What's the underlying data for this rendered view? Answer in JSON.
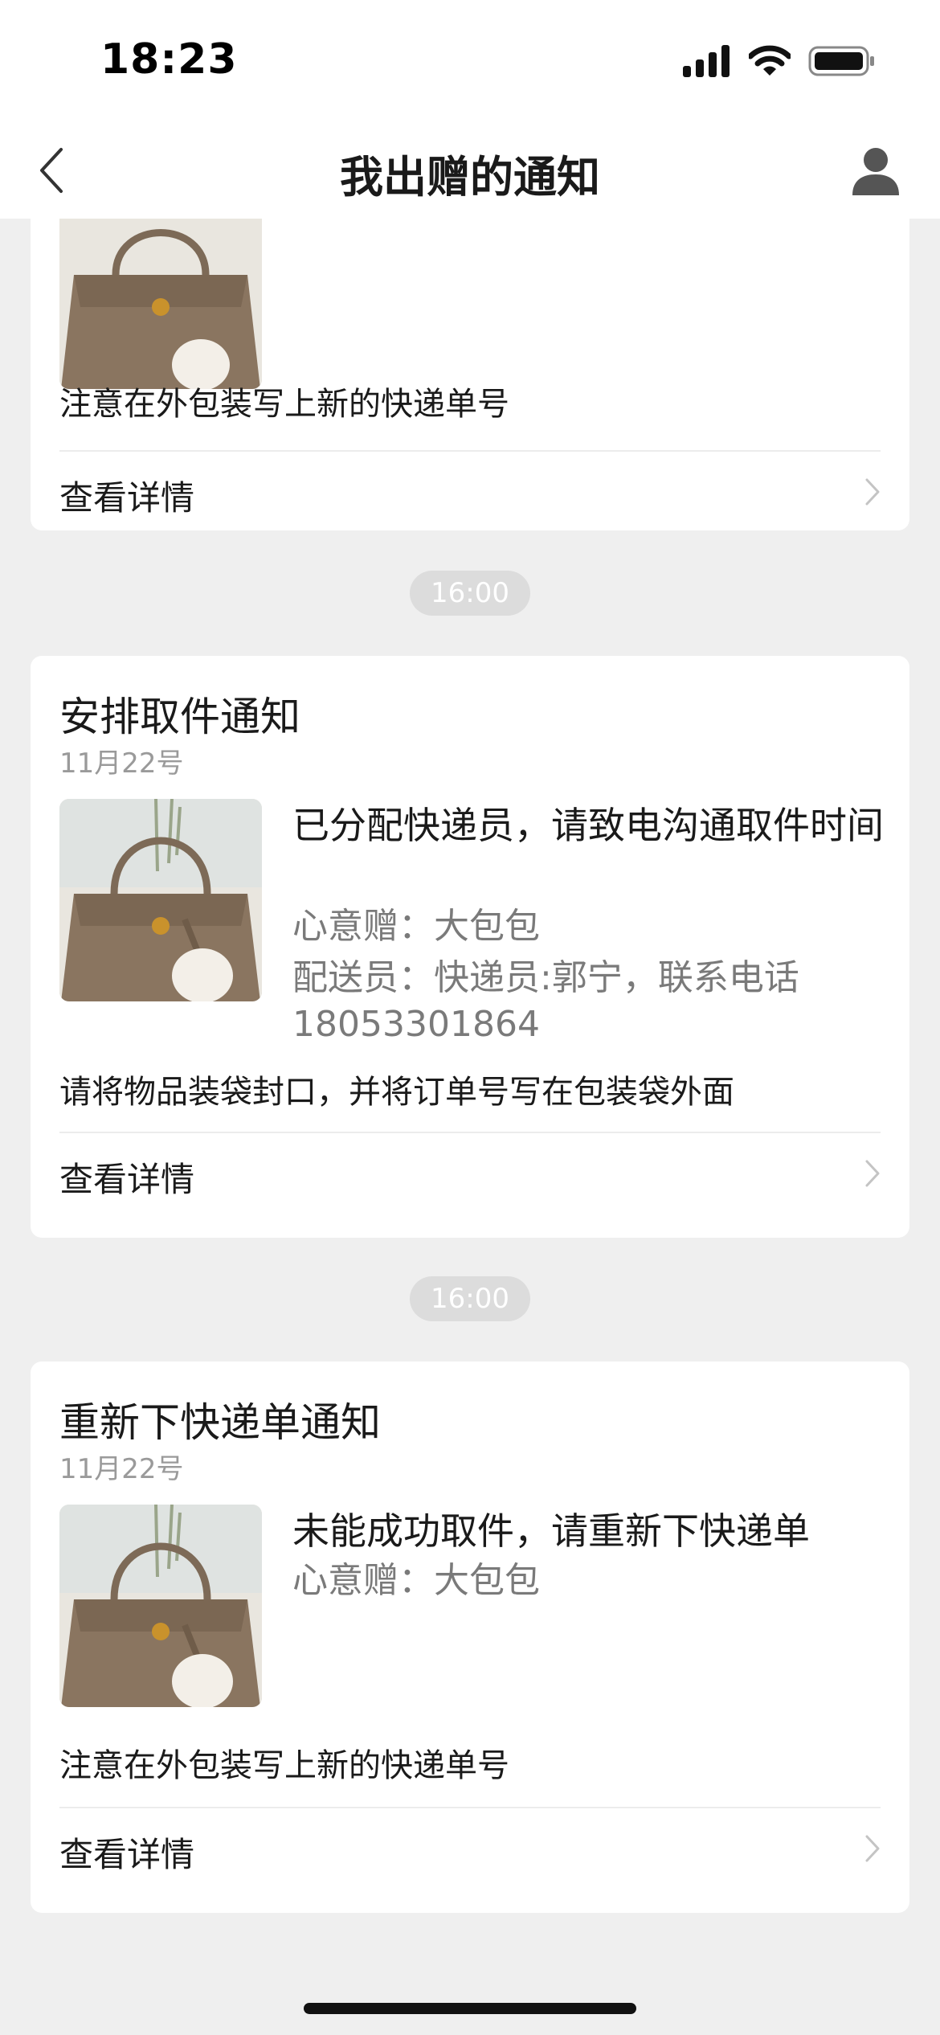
{
  "status_bar": {
    "time": "18:23"
  },
  "nav": {
    "title": "我出赠的通知"
  },
  "cards": [
    {
      "note": "注意在外包装写上新的快递单号",
      "view_detail": "查看详情"
    },
    {
      "time_label": "16:00",
      "title": "安排取件通知",
      "date": "11月22号",
      "main": "已分配快递员，请致电沟通取件时间",
      "gift": "心意赠：大包包",
      "courier": "配送员：快递员:郭宁，联系电话18053301864",
      "note": "请将物品装袋封口，并将订单号写在包装袋外面",
      "view_detail": "查看详情"
    },
    {
      "time_label": "16:00",
      "title": "重新下快递单通知",
      "date": "11月22号",
      "main": "未能成功取件，请重新下快递单",
      "gift": "心意赠：大包包",
      "note": "注意在外包装写上新的快递单号",
      "view_detail": "查看详情"
    }
  ],
  "colors": {
    "background": "#efefef",
    "card": "#ffffff",
    "time_pill": "#dcdcdc",
    "secondary_text": "#7a7a7a",
    "bag_brown": "#8a7560"
  },
  "icons": {
    "back": "chevron-left-icon",
    "profile": "user-icon",
    "row_arrow": "chevron-right-icon"
  }
}
